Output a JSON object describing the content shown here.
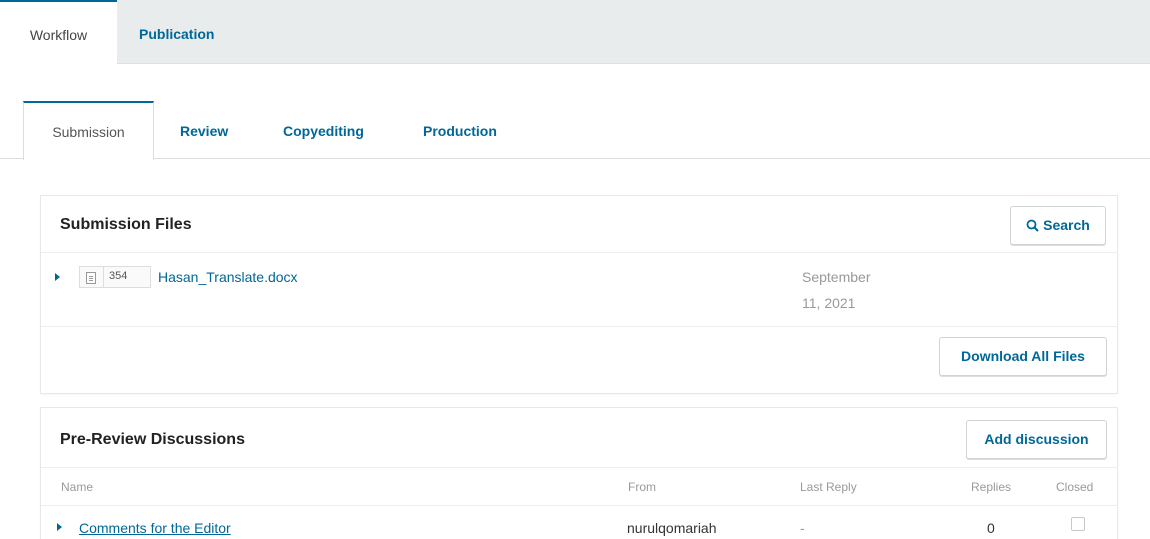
{
  "top_tabs": [
    {
      "label": "Workflow",
      "active": true
    },
    {
      "label": "Publication",
      "active": false
    }
  ],
  "stage_tabs": [
    {
      "label": "Submission",
      "active": true
    },
    {
      "label": "Review",
      "active": false
    },
    {
      "label": "Copyediting",
      "active": false
    },
    {
      "label": "Production",
      "active": false
    }
  ],
  "submission_files": {
    "title": "Submission Files",
    "search_label": "Search",
    "files": [
      {
        "id": "354",
        "name": "Hasan_Translate.docx",
        "date_line1": "September",
        "date_line2": "11, 2021"
      }
    ],
    "download_all_label": "Download All Files"
  },
  "discussions": {
    "title": "Pre-Review Discussions",
    "add_label": "Add discussion",
    "columns": {
      "name": "Name",
      "from": "From",
      "last_reply": "Last Reply",
      "replies": "Replies",
      "closed": "Closed"
    },
    "rows": [
      {
        "name": "Comments for the Editor",
        "from": "nurulqomariah",
        "last_reply": "-",
        "replies": "0",
        "closed": false
      }
    ]
  },
  "colors": {
    "accent": "#006798",
    "topbar": "#e9ecec"
  }
}
